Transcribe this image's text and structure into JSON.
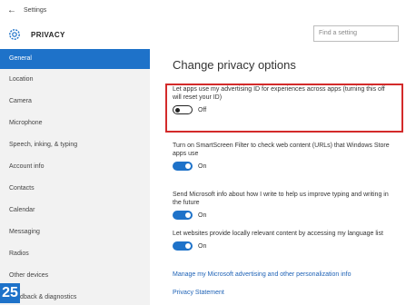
{
  "titlebar": {
    "back_glyph": "←",
    "app_title": "Settings"
  },
  "header": {
    "section_title": "PRIVACY",
    "search_placeholder": "Find a setting",
    "icon": "gear-icon"
  },
  "sidebar": {
    "items": [
      {
        "label": "General",
        "active": true
      },
      {
        "label": "Location"
      },
      {
        "label": "Camera"
      },
      {
        "label": "Microphone"
      },
      {
        "label": "Speech, inking, & typing"
      },
      {
        "label": "Account info"
      },
      {
        "label": "Contacts"
      },
      {
        "label": "Calendar"
      },
      {
        "label": "Messaging"
      },
      {
        "label": "Radios"
      },
      {
        "label": "Other devices"
      },
      {
        "label": "Feedback & diagnostics"
      }
    ]
  },
  "main": {
    "title": "Change privacy options",
    "settings": [
      {
        "description": "Let apps use my advertising ID for experiences across apps (turning this off will reset your ID)",
        "state": "Off",
        "highlighted": true
      },
      {
        "description": "Turn on SmartScreen Filter to check web content (URLs) that Windows Store apps use",
        "state": "On"
      },
      {
        "description": "Send Microsoft info about how I write to help us improve typing and writing in the future",
        "state": "On"
      },
      {
        "description": "Let websites provide locally relevant content by accessing my language list",
        "state": "On"
      }
    ],
    "links": [
      "Manage my Microsoft advertising and other personalization info",
      "Privacy Statement"
    ]
  },
  "badge": {
    "text": "25"
  },
  "colors": {
    "accent": "#1e72c9",
    "highlight_border": "#d32a2a"
  }
}
